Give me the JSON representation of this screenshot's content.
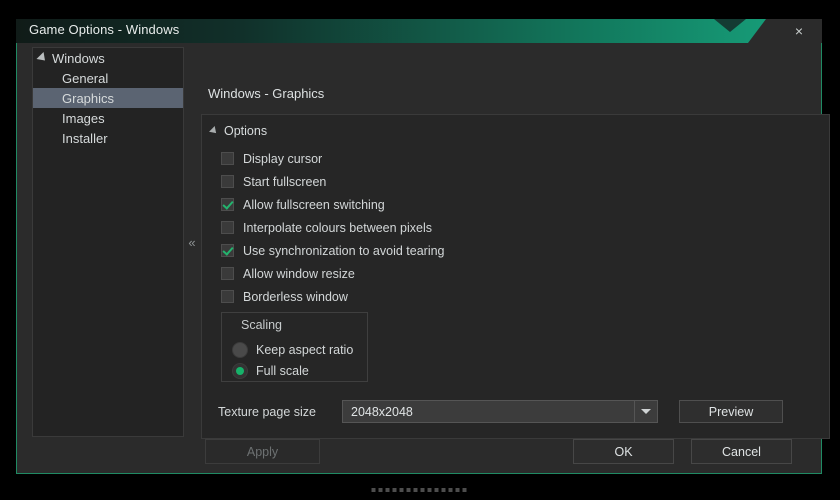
{
  "titlebar": {
    "title": "Game Options - Windows",
    "close_label": "×"
  },
  "sidebar": {
    "items": [
      {
        "label": "Windows",
        "level": "root",
        "selected": false,
        "expander": true
      },
      {
        "label": "General",
        "level": "child",
        "selected": false,
        "expander": false
      },
      {
        "label": "Graphics",
        "level": "child",
        "selected": true,
        "expander": false
      },
      {
        "label": "Images",
        "level": "child",
        "selected": false,
        "expander": false
      },
      {
        "label": "Installer",
        "level": "child",
        "selected": false,
        "expander": false
      }
    ],
    "collapse_chevron": "«"
  },
  "content": {
    "title": "Windows - Graphics",
    "group_label": "Options",
    "checkboxes": [
      {
        "label": "Display cursor",
        "checked": false
      },
      {
        "label": "Start fullscreen",
        "checked": false
      },
      {
        "label": "Allow fullscreen switching",
        "checked": true
      },
      {
        "label": "Interpolate colours between pixels",
        "checked": false
      },
      {
        "label": "Use synchronization to avoid tearing",
        "checked": true
      },
      {
        "label": "Allow window resize",
        "checked": false
      },
      {
        "label": "Borderless window",
        "checked": false
      }
    ],
    "scaling": {
      "legend": "Scaling",
      "options": [
        {
          "label": "Keep aspect ratio",
          "selected": false
        },
        {
          "label": "Full scale",
          "selected": true
        }
      ]
    },
    "texture": {
      "label": "Texture page size",
      "value": "2048x2048",
      "preview_label": "Preview"
    }
  },
  "footer": {
    "apply_label": "Apply",
    "ok_label": "OK",
    "cancel_label": "Cancel"
  },
  "colors": {
    "accent_green": "#17b26a",
    "titlebar_green": "#179f7a",
    "selection_blue": "#5b6472",
    "window_bg": "#2b2b2b"
  }
}
